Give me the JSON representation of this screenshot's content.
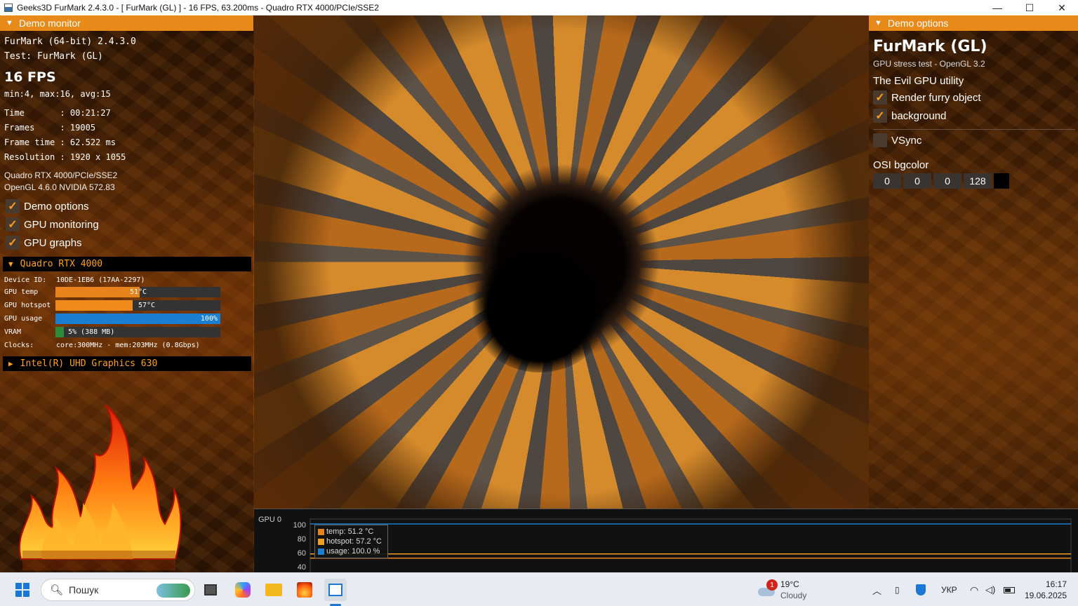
{
  "window": {
    "title": "Geeks3D FurMark 2.4.3.0 - [ FurMark (GL) ] - 16 FPS, 63.200ms - Quadro RTX 4000/PCIe/SSE2",
    "minimize": "—",
    "maximize": "☐",
    "close": "✕"
  },
  "demo_monitor": {
    "header": "Demo monitor",
    "app_line": "FurMark (64-bit) 2.4.3.0",
    "test_line": "Test: FurMark (GL)",
    "fps": "16 FPS",
    "fps_stats": "min:4, max:16, avg:15",
    "time_line": "Time       : 00:21:27",
    "frames_line": "Frames     : 19005",
    "frametime_line": "Frame time : 62.522 ms",
    "resolution_line": "Resolution : 1920 x 1055",
    "renderer": "Quadro RTX 4000/PCIe/SSE2",
    "opengl": "OpenGL 4.6.0 NVIDIA 572.83",
    "checkboxes": [
      {
        "label": "Demo options",
        "checked": true
      },
      {
        "label": "GPU monitoring",
        "checked": true
      },
      {
        "label": "GPU graphs",
        "checked": true
      }
    ]
  },
  "gpu0": {
    "name": "Quadro RTX 4000",
    "device_label": "Device ID:",
    "device_id": "10DE-1EB6 (17AA-2297)",
    "temp_label": "GPU temp",
    "temp_text": "51°C",
    "temp_fraction": 0.51,
    "hotspot_label": "GPU hotspot",
    "hotspot_text": "57°C",
    "hotspot_fraction": 0.47,
    "usage_label": "GPU usage",
    "usage_text": "100%",
    "usage_fraction": 1.0,
    "vram_label": "VRAM",
    "vram_text": "5% (388 MB)",
    "vram_fraction": 0.05,
    "clocks_label": "Clocks:",
    "clocks_text": "core:300MHz - mem:203MHz (0.8Gbps)"
  },
  "gpu1": {
    "name": "Intel(R) UHD Graphics 630"
  },
  "demo_options": {
    "header": "Demo options",
    "title": "FurMark (GL)",
    "subtitle": "GPU stress test - OpenGL 3.2",
    "utility": "The Evil GPU utility",
    "render_furry": "Render furry object",
    "background": "background",
    "vsync": "VSync",
    "osi_label": "OSI bgcolor",
    "osi_values": [
      "0",
      "0",
      "0",
      "128"
    ]
  },
  "graph": {
    "label": "GPU 0",
    "yticks": [
      "100",
      "80",
      "60",
      "40"
    ],
    "legend": [
      {
        "text": "temp: 51.2 °C",
        "color": "#e8821a"
      },
      {
        "text": "hotspot: 57.2 °C",
        "color": "#f0a020"
      },
      {
        "text": "usage: 100.0 %",
        "color": "#1a7fd0"
      }
    ],
    "series_values": {
      "temp": 51.2,
      "hotspot": 57.2,
      "usage": 100.0
    }
  },
  "colors": {
    "accent": "#e88a1a",
    "usage_bar": "#1a7fd0",
    "vram_bar": "#2e8b3a"
  },
  "taskbar": {
    "search_placeholder": "Пошук",
    "weather_temp": "19°C",
    "weather_desc": "Cloudy",
    "weather_badge": "1",
    "language": "УКР",
    "time": "16:17",
    "date": "19.06.2025"
  }
}
